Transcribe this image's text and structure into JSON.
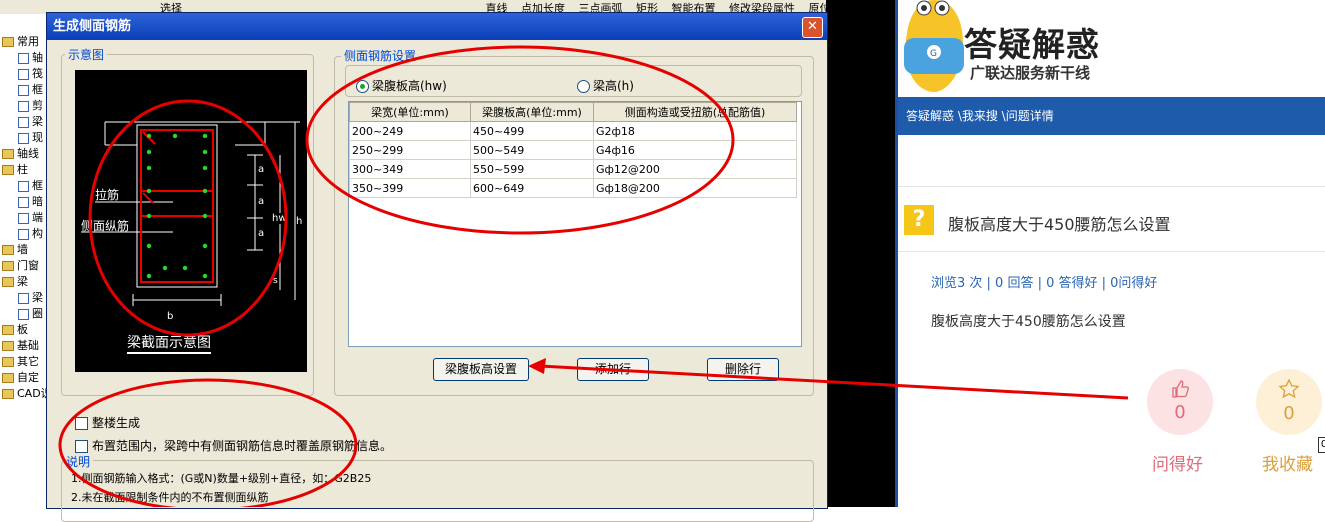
{
  "cad": {
    "toolbar": [
      "选择",
      "直线",
      "点加长度",
      "三点画弧",
      "矩形",
      "智能布置",
      "修改梁段属性",
      "原位标注"
    ],
    "tree": [
      {
        "label": "常用",
        "type": "folder"
      },
      {
        "label": "轴",
        "type": "item"
      },
      {
        "label": "筏",
        "type": "item"
      },
      {
        "label": "框",
        "type": "item"
      },
      {
        "label": "剪",
        "type": "item"
      },
      {
        "label": "梁",
        "type": "item"
      },
      {
        "label": "现",
        "type": "item"
      },
      {
        "label": "轴线",
        "type": "folder"
      },
      {
        "label": "柱",
        "type": "folder"
      },
      {
        "label": "框",
        "type": "item"
      },
      {
        "label": "暗",
        "type": "item"
      },
      {
        "label": "端",
        "type": "item"
      },
      {
        "label": "构",
        "type": "item"
      },
      {
        "label": "墙",
        "type": "folder"
      },
      {
        "label": "门窗",
        "type": "folder"
      },
      {
        "label": "梁",
        "type": "folder"
      },
      {
        "label": "梁",
        "type": "item"
      },
      {
        "label": "圈",
        "type": "item"
      },
      {
        "label": "板",
        "type": "folder"
      },
      {
        "label": "基础",
        "type": "folder"
      },
      {
        "label": "其它",
        "type": "folder"
      },
      {
        "label": "自定",
        "type": "folder"
      },
      {
        "label": "CAD识",
        "type": "folder"
      }
    ]
  },
  "dialog": {
    "title": "生成侧面钢筋",
    "close": "✕",
    "preview_group": "示意图",
    "preview": {
      "tie_bar": "拉筋",
      "side_long_bar": "侧面纵筋",
      "caption": "梁截面示意图",
      "dim_a": "a",
      "dim_hw": "hw",
      "dim_h": "h",
      "dim_b": "b",
      "dim_s": "s"
    },
    "settings_group": "侧面钢筋设置",
    "radio_hw": "梁腹板高(hw)",
    "radio_h": "梁高(h)",
    "table": {
      "columns": [
        "梁宽(单位:mm)",
        "梁腹板高(单位:mm)",
        "侧面构造或受扭筋(总配筋值)"
      ],
      "rows": [
        [
          "200~249",
          "450~499",
          "G2ф18"
        ],
        [
          "250~299",
          "500~549",
          "G4ф16"
        ],
        [
          "300~349",
          "550~599",
          "Gф12@200"
        ],
        [
          "350~399",
          "600~649",
          "Gф18@200"
        ]
      ]
    },
    "buttons": {
      "web_height": "梁腹板高设置",
      "add_row": "添加行",
      "delete_row": "删除行"
    },
    "check_whole": "整楼生成",
    "check_override": "布置范围内，梁跨中有侧面钢筋信息时覆盖原钢筋信息。",
    "notes_title": "说明",
    "note1": "1.侧面钢筋输入格式：(G或N)数量+级别+直径，如：G2B25",
    "note2": "2.未在截面限制条件内的不布置侧面纵筋"
  },
  "web": {
    "logo_title": "答疑解惑",
    "logo_subtitle": "广联达服务新干线",
    "breadcrumb": "答疑解惑 \\我来搜 \\问题详情",
    "question_title": "腹板高度大于450腰筋怎么设置",
    "stats": "浏览3 次 | 0 回答 | 0 答得好 | 0问得好",
    "question_body": "腹板高度大于450腰筋怎么设置",
    "like_count": "0",
    "like_label": "问得好",
    "fav_count": "0",
    "fav_label": "我收藏",
    "edge_badge": "0"
  },
  "colors": {
    "titlebar": "#0a3fb7",
    "group_title": "#0046d5",
    "nav": "#1e5cab",
    "like_bg": "#fde2e4",
    "like_fg": "#e06a7a",
    "fav_bg": "#fdf0d6",
    "fav_fg": "#d9a03c",
    "annotation_red": "#e60000"
  }
}
